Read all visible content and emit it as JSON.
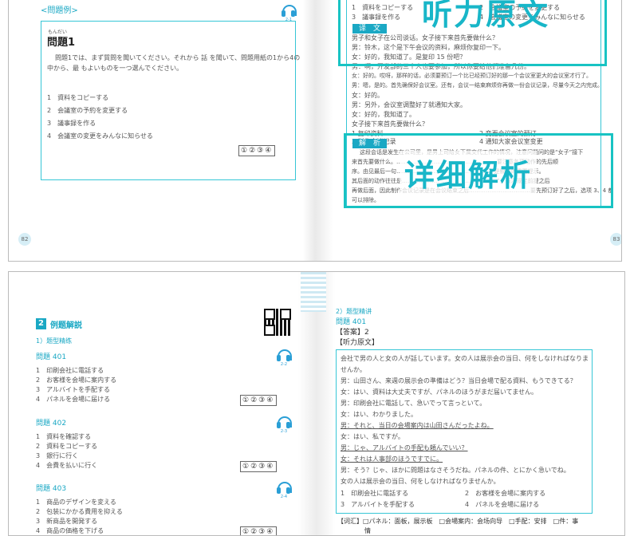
{
  "top_left": {
    "mondai_rei": "<問題例>",
    "furigana_mondai": "もんだい",
    "title": "問題1",
    "track": "2-1",
    "instruction_1": "問題1では、まず質問を聞いてください。それから 話 を聞いて、問題用紙の1から4の",
    "instruction_2": "中から、最 もよいものを一つ選んでください。",
    "options": [
      "1　資料をコピーする",
      "2　会議室の予約を変更する",
      "3　議事録を作る",
      "4　会議室の変更をみんなに知らせる"
    ],
    "answer_choices": "①②③④",
    "page_number": "82"
  },
  "top_right": {
    "options_top": [
      "1　資料をコピーする",
      "3　議事録を作る"
    ],
    "options_top_right": [
      "2　会議室の予約を変更する",
      "4　会議室の変更をみんなに知らせる"
    ],
    "overlay_listen": "听力原文",
    "pill_translation": "译　文",
    "translation_lines": [
      "男子和女子在公司谈话。女子接下来首先要做什么？",
      "男：铃木，这个是下午会议的资料，麻烦你复印一下。",
      "女：好的，我知道了。是复印 15 份吧？",
      "男：啊，开发部的三个人也要参加，所以你要给他们准备几份。",
      "女：好的。哎呀，那样的话，必须要预订一个比已经预订好的那一个会议室更大的会议室才行了。",
      "男：嗯，是的。首先确保好会议室。还有，会议一结束麻烦你再做一份会议记录，尽量今天之内完成。",
      "女：好的。",
      "男：另外，会议室调整好了就通知大家。",
      "女：好的，我知道了。",
      "女子接下来首先要做什么？"
    ],
    "tr_options_left": [
      "1 复印资料",
      "3 制作会议记录"
    ],
    "tr_options_right": [
      "2 变更会议室的预订",
      "4 通知大家会议室变更"
    ],
    "pill_analysis": "解　析",
    "overlay_analysis": "详细解析",
    "analysis_lines": [
      "这段会话是发生在公司里，是男上司给女下属交代工作的情况，注意问题问的是“女子”接下",
      "来首先要做什么。……………………………………………，要注意各项动作的先后顺",
      "序。由见最后一句……………………………………………”是解题的重要提示。",
      "其后面的动作往往是……………………………………………”，表示规定前提之后",
      "再做后面，因此制作会议记录是在会议结束之后……………………………要先预订好了之后，选项 3、4 都",
      "可以排除。"
    ],
    "page_number": "83"
  },
  "bottom_left": {
    "section_num": "2",
    "section_title": "例题解説",
    "sub_heading": "1）题型精练",
    "q401": {
      "label": "問題 401",
      "track": "2-2",
      "options": [
        "1　印刷会社に電話する",
        "2　お客様を会場に案内する",
        "3　アルバイトを手配する",
        "4　パネルを会場に届ける"
      ],
      "answer_choices": "①②③④"
    },
    "q402": {
      "label": "問題 402",
      "track": "2-3",
      "options": [
        "1　資料を確認する",
        "2　資料をコピーする",
        "3　銀行に行く",
        "4　会費を払いに行く"
      ],
      "answer_choices": "①②③④"
    },
    "q403": {
      "label": "問題 403",
      "track": "2-4",
      "options": [
        "1　商品のデザインを変える",
        "2　包装にかかる費用を抑える",
        "3　新商品を開発する",
        "4　商品の価格を下げる"
      ],
      "answer_choices": "①②③④"
    }
  },
  "bottom_right": {
    "sub_heading": "2）题型精讲",
    "question_label": "問題 401",
    "answer_label": "【答案】2",
    "listening_label": "【听力原文】",
    "script_lines": [
      "会社で男の人と女の人が話しています。女の人は展示会の当日、何をしなければなりま",
      "せんか。",
      "男：山田さん、来週の展示会の準備はどう？当日会場で配る資料、もうできてる？",
      "女：はい、資料は大丈夫ですが、パネルのほうがまだ届いてません。",
      "男：印刷会社に電話して、急いでって言っといて。",
      "女：はい、わかりました。",
      "男：それと、当日の会場案内は山田さんだったよね。",
      "女：はい、私ですが。",
      "男：じゃ、アルバイトの手配も頼んでいい？",
      "女：それは人事部のほうですでに。",
      "男：そう？じゃ、ほかに問題はなさそうだね。パネルの件、とにかく急いでね。",
      "女の人は展示会の当日、何をしなければなりませんか。"
    ],
    "options_left": [
      "1　印刷会社に電話する",
      "3　アルバイトを手配する"
    ],
    "options_right": [
      "2　お客様を会場に案内する",
      "4　パネルを会場に届ける"
    ],
    "vocab_line_1": "【词汇】□パネル：面板，展示板　□会場案内：会场向导　□手配：安排　□件：事",
    "vocab_line_2": "情"
  },
  "colors": {
    "accent": "#1aa8c4",
    "highlight_box": "#18c3c3",
    "headphone": "#2a9fd6"
  },
  "icons": [
    "headphone-icon",
    "qr-code-icon"
  ]
}
